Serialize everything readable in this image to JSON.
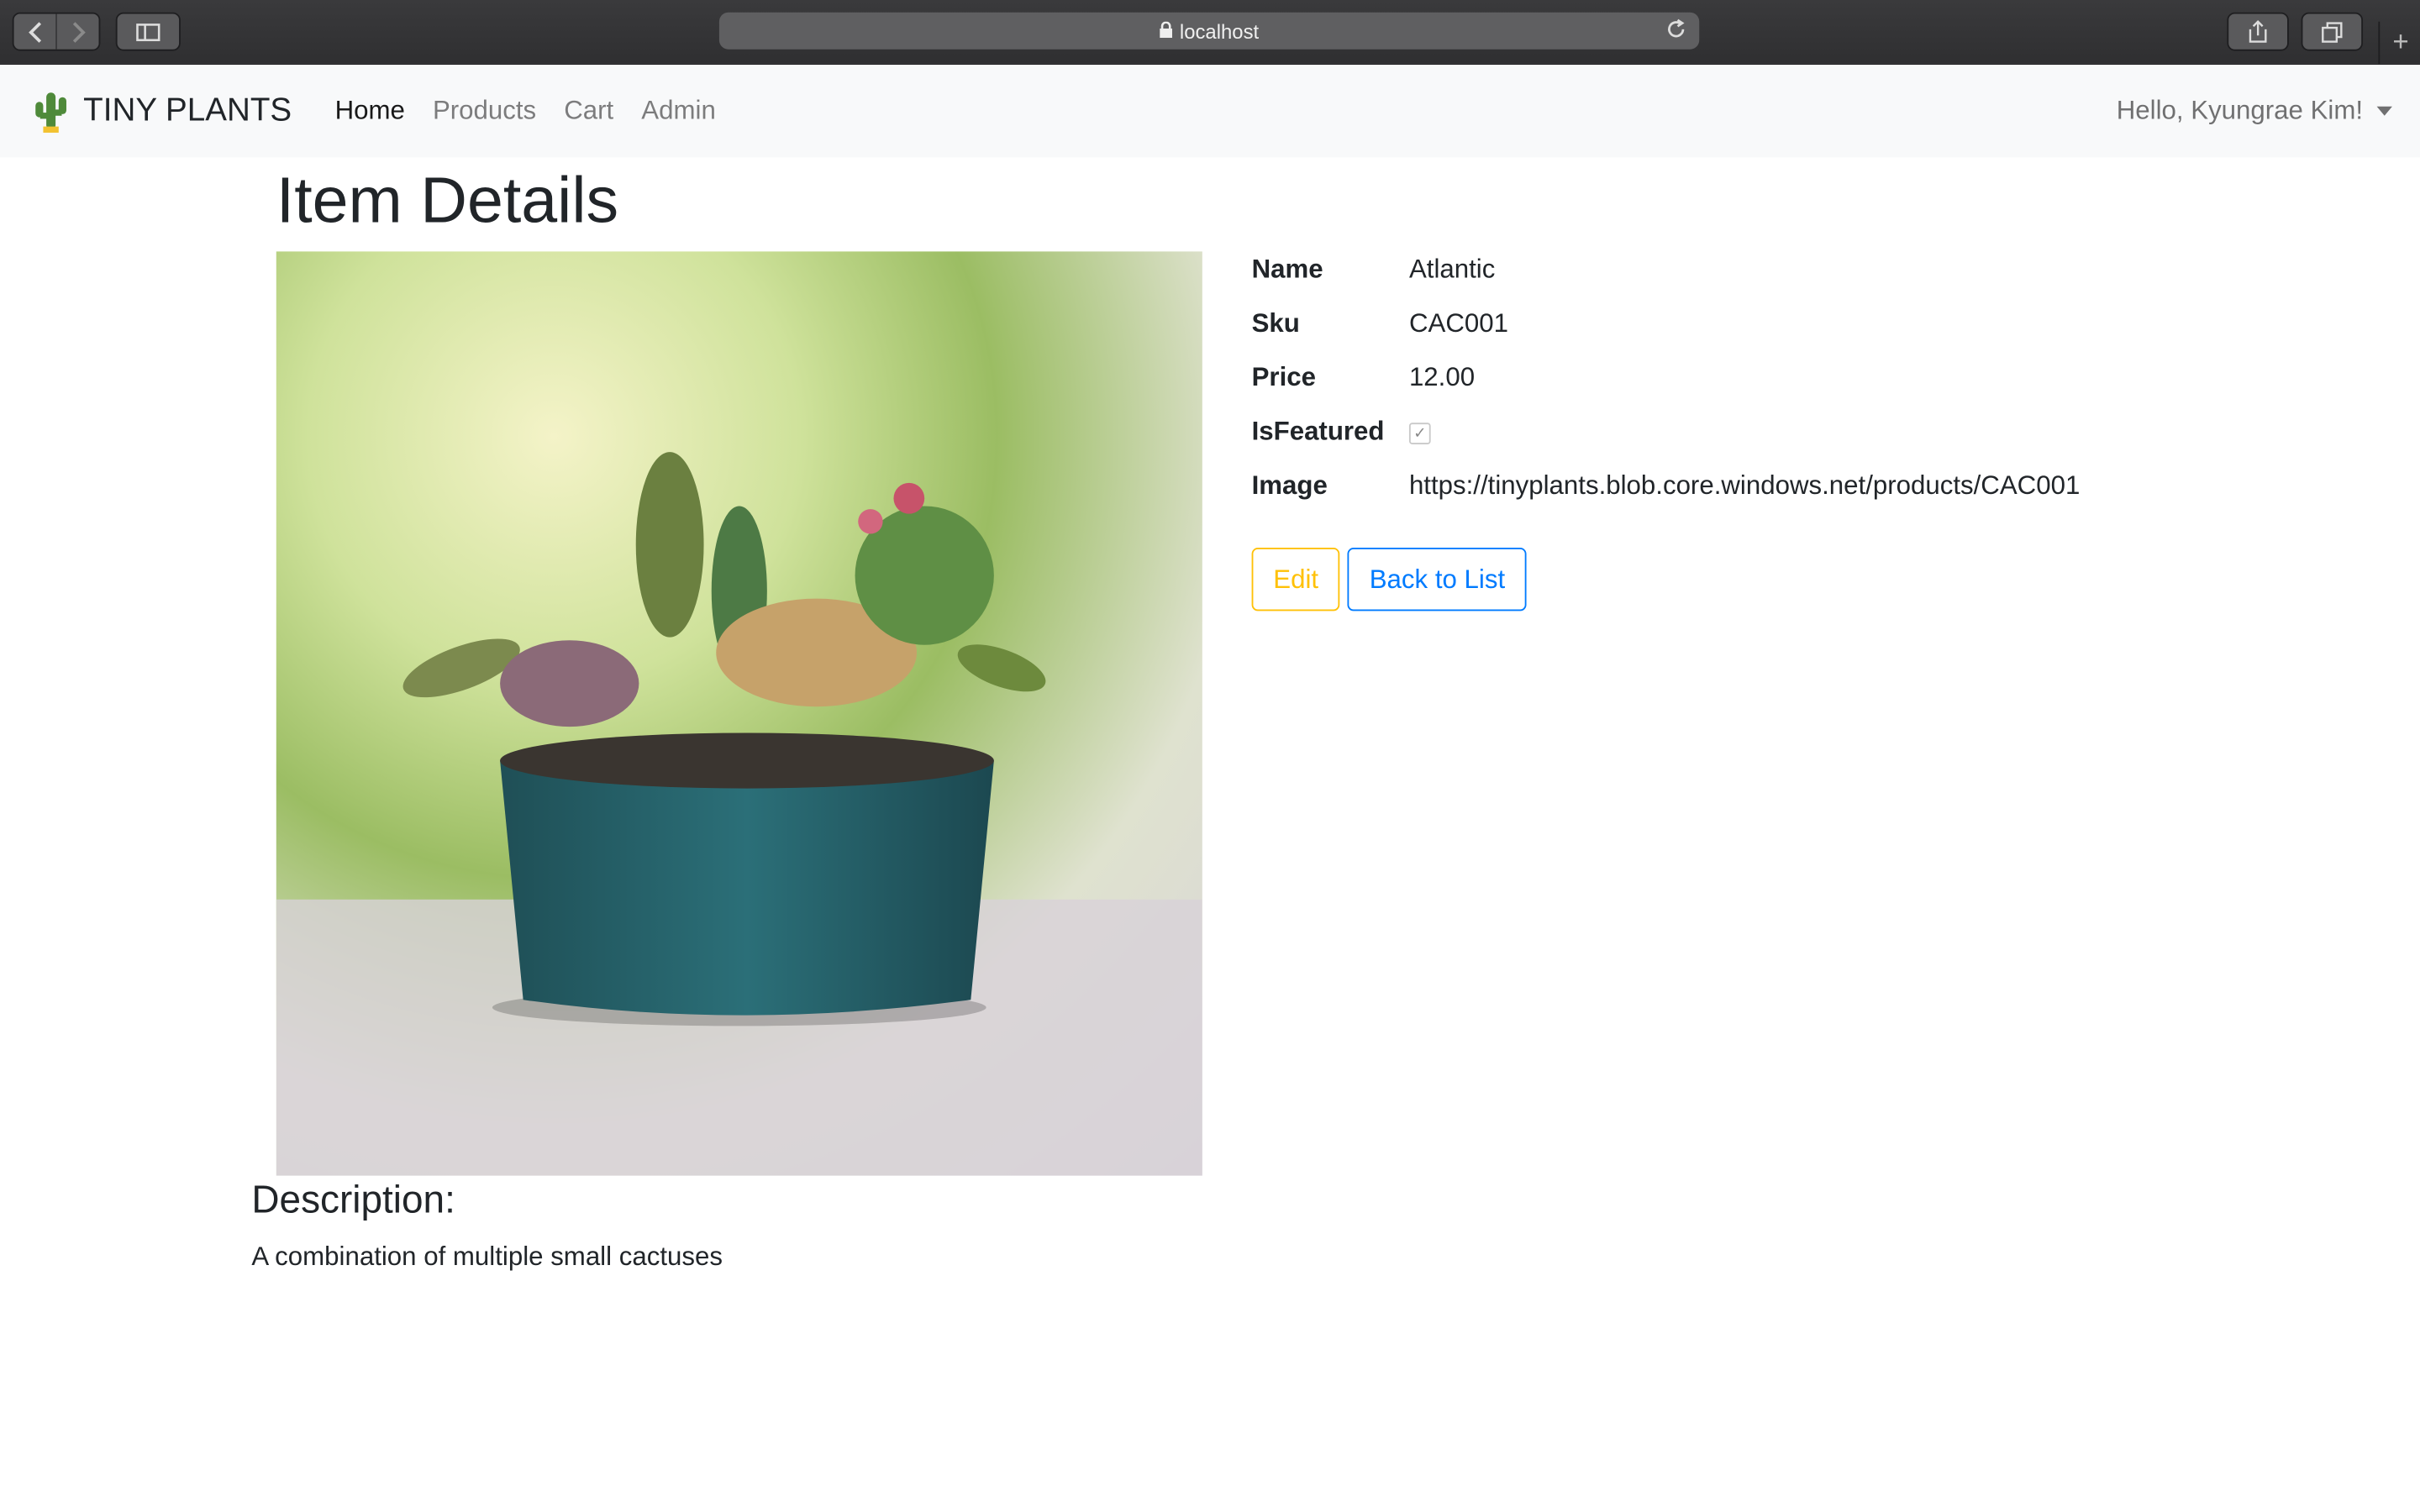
{
  "browser": {
    "address": "localhost",
    "icons": [
      "back-icon",
      "forward-icon",
      "sidebar-icon",
      "lock-icon",
      "reload-icon",
      "share-icon",
      "tabs-icon",
      "new-tab-icon"
    ]
  },
  "navbar": {
    "brand": "TINY PLANTS",
    "links": [
      "Home",
      "Products",
      "Cart",
      "Admin"
    ],
    "user": "Hello, Kyungrae Kim!"
  },
  "page": {
    "title": "Item Details",
    "fields": [
      {
        "label": "Name",
        "value": "Atlantic"
      },
      {
        "label": "Sku",
        "value": "CAC001"
      },
      {
        "label": "Price",
        "value": "12.00"
      },
      {
        "label": "IsFeatured",
        "value": true
      },
      {
        "label": "Image",
        "value": "https://tinyplants.blob.core.windows.net/products/CAC001"
      }
    ],
    "edit_label": "Edit",
    "back_label": "Back to List",
    "description_heading": "Description:",
    "description": "A combination of multiple small cactuses"
  },
  "colors": {
    "warning": "#ffc107",
    "primary": "#007bff"
  }
}
